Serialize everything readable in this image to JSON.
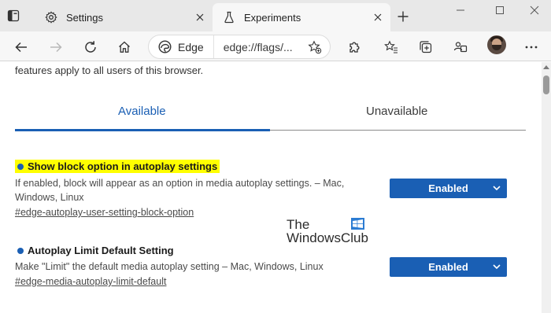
{
  "tabs": [
    {
      "title": "Settings",
      "icon": "gear-icon",
      "active": false
    },
    {
      "title": "Experiments",
      "icon": "flask-icon",
      "active": true
    }
  ],
  "address_bar": {
    "identity_label": "Edge",
    "url": "edge://flags/..."
  },
  "page": {
    "intro_text": "features apply to all users of this browser.",
    "content_tabs": {
      "available": "Available",
      "unavailable": "Unavailable",
      "selected": "Available"
    },
    "flags": [
      {
        "title": "Show block option in autoplay settings",
        "highlighted": true,
        "description": "If enabled, block will appear as an option in media autoplay settings. – Mac, Windows, Linux",
        "link": "#edge-autoplay-user-setting-block-option",
        "value": "Enabled"
      },
      {
        "title": "Autoplay Limit Default Setting",
        "highlighted": false,
        "description": "Make \"Limit\" the default media autoplay setting – Mac, Windows, Linux",
        "link": "#edge-media-autoplay-limit-default",
        "value": "Enabled"
      }
    ]
  },
  "watermark": {
    "line1": "The",
    "line2": "WindowsClub"
  },
  "colors": {
    "accent": "#1a5fb4",
    "highlight": "#ffff00",
    "tabstrip": "#e8e8e8",
    "toolbar": "#f7f7f7"
  }
}
